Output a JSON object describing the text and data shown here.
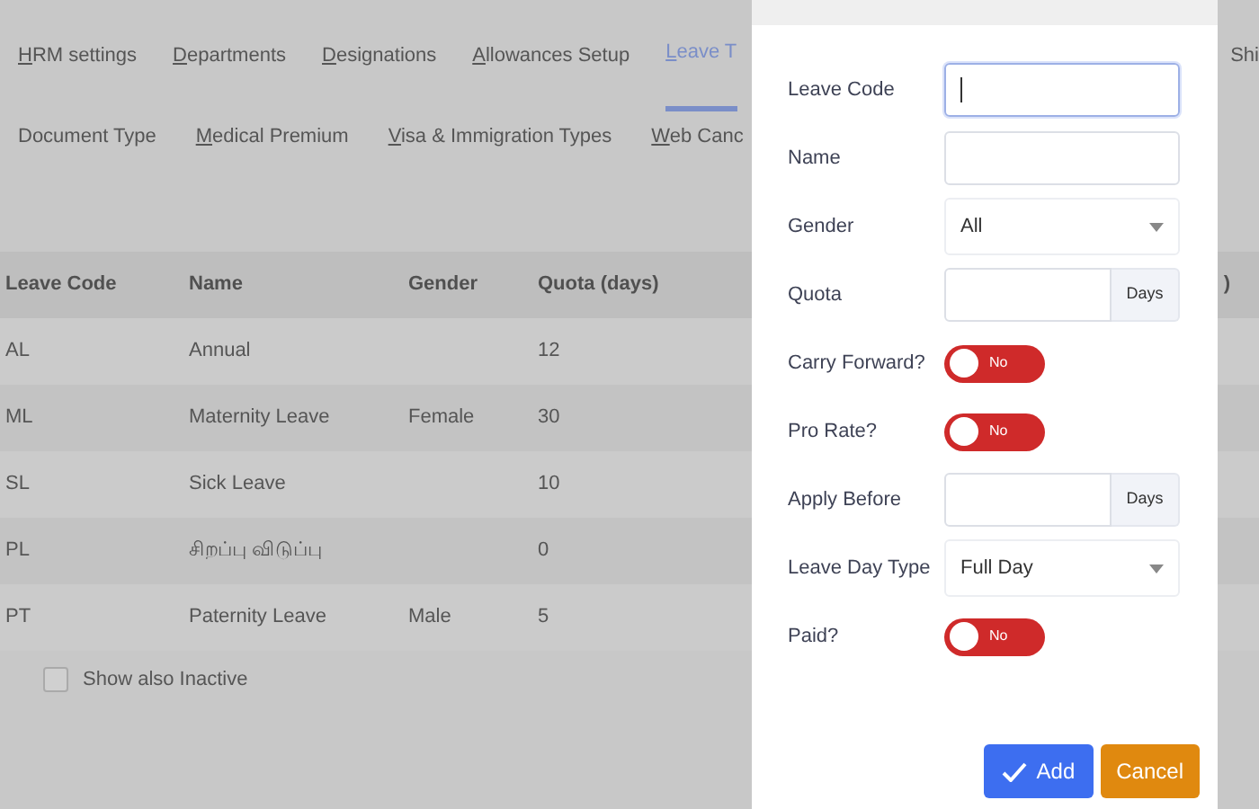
{
  "tabs": [
    {
      "label": "HRM settings",
      "underline_first": true,
      "selected": false
    },
    {
      "label": "Departments",
      "underline_first": true,
      "selected": false
    },
    {
      "label": "Designations",
      "underline_first": true,
      "selected": false
    },
    {
      "label": "Allowances Setup",
      "underline_first": true,
      "selected": false
    },
    {
      "label": "Leave T",
      "underline_first": true,
      "selected": true
    },
    {
      "label": "Shi",
      "underline_first": false,
      "selected": false
    }
  ],
  "subtabs": [
    {
      "label": "Document Type",
      "underline_first": false
    },
    {
      "label": "Medical Premium",
      "underline_first": true
    },
    {
      "label": "Visa & Immigration Types",
      "underline_first": true
    },
    {
      "label": "Web Canc",
      "underline_first": true
    }
  ],
  "table": {
    "columns": [
      "Leave Code",
      "Name",
      "Gender",
      "Quota (days)"
    ],
    "column_7": ")",
    "rows": [
      [
        "AL",
        "Annual",
        "",
        "12"
      ],
      [
        "ML",
        "Maternity Leave",
        "Female",
        "30"
      ],
      [
        "SL",
        "Sick Leave",
        "",
        "10"
      ],
      [
        "PL",
        "சிறப்பு விடுப்பு",
        "",
        "0"
      ],
      [
        "PT",
        "Paternity Leave",
        "Male",
        "5"
      ]
    ]
  },
  "show_inactive": {
    "label": "Show also Inactive",
    "checked": false
  },
  "modal": {
    "fields": [
      {
        "kind": "text",
        "label": "Leave Code",
        "focused": true
      },
      {
        "kind": "text",
        "label": "Name",
        "focused": false
      },
      {
        "kind": "select",
        "label": "Gender",
        "value": "All"
      },
      {
        "kind": "addon",
        "label": "Quota",
        "addon": "Days"
      },
      {
        "kind": "toggle",
        "label": "Carry Forward?",
        "on": false,
        "text": "No"
      },
      {
        "kind": "toggle",
        "label": "Pro Rate?",
        "on": false,
        "text": "No"
      },
      {
        "kind": "addon",
        "label": "Apply Before",
        "addon": "Days"
      },
      {
        "kind": "select",
        "label": "Leave Day Type",
        "value": "Full Day"
      },
      {
        "kind": "toggle",
        "label": "Paid?",
        "on": false,
        "text": "No"
      }
    ],
    "buttons": [
      {
        "kind": "primary",
        "label": "Add"
      },
      {
        "kind": "cancel",
        "label": "Cancel"
      }
    ]
  }
}
